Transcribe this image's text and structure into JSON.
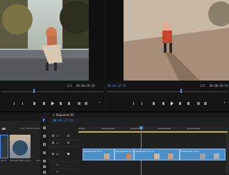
{
  "colors": {
    "accent": "#3a7bd5",
    "panel": "#1d1d1d",
    "clip": "#4a8fc7"
  },
  "source_monitor": {
    "zoom": "1/2",
    "timecode": "00:00:28:18"
  },
  "program_monitor": {
    "timecode_left": "00:03:37:15",
    "zoom": "1/2",
    "timecode_right": "00:00:10:19"
  },
  "project_panel": {
    "items_selected": "1 of 4 items selected",
    "thumbnails": [
      {
        "label": "Sample Video (5).m...",
        "duration": "39:07"
      },
      {
        "label": "Sample Video (4).m...",
        "duration": "10:19"
      }
    ]
  },
  "timeline": {
    "sequence_name": "Sequence 01",
    "timecode": "00:03:37:15",
    "ruler_marks": [
      "00:00",
      "00:00:15:00",
      "00:00:30:00",
      "00:00:45:00",
      "00:01:00:00"
    ],
    "tracks": [
      "V3",
      "V2",
      "V1",
      "A1",
      "A2"
    ],
    "clips": [
      "Sample Video (5).m...",
      "Sample Video (5).m...",
      "Sample Video (5).m...",
      "Sample Video (4).m..."
    ]
  }
}
